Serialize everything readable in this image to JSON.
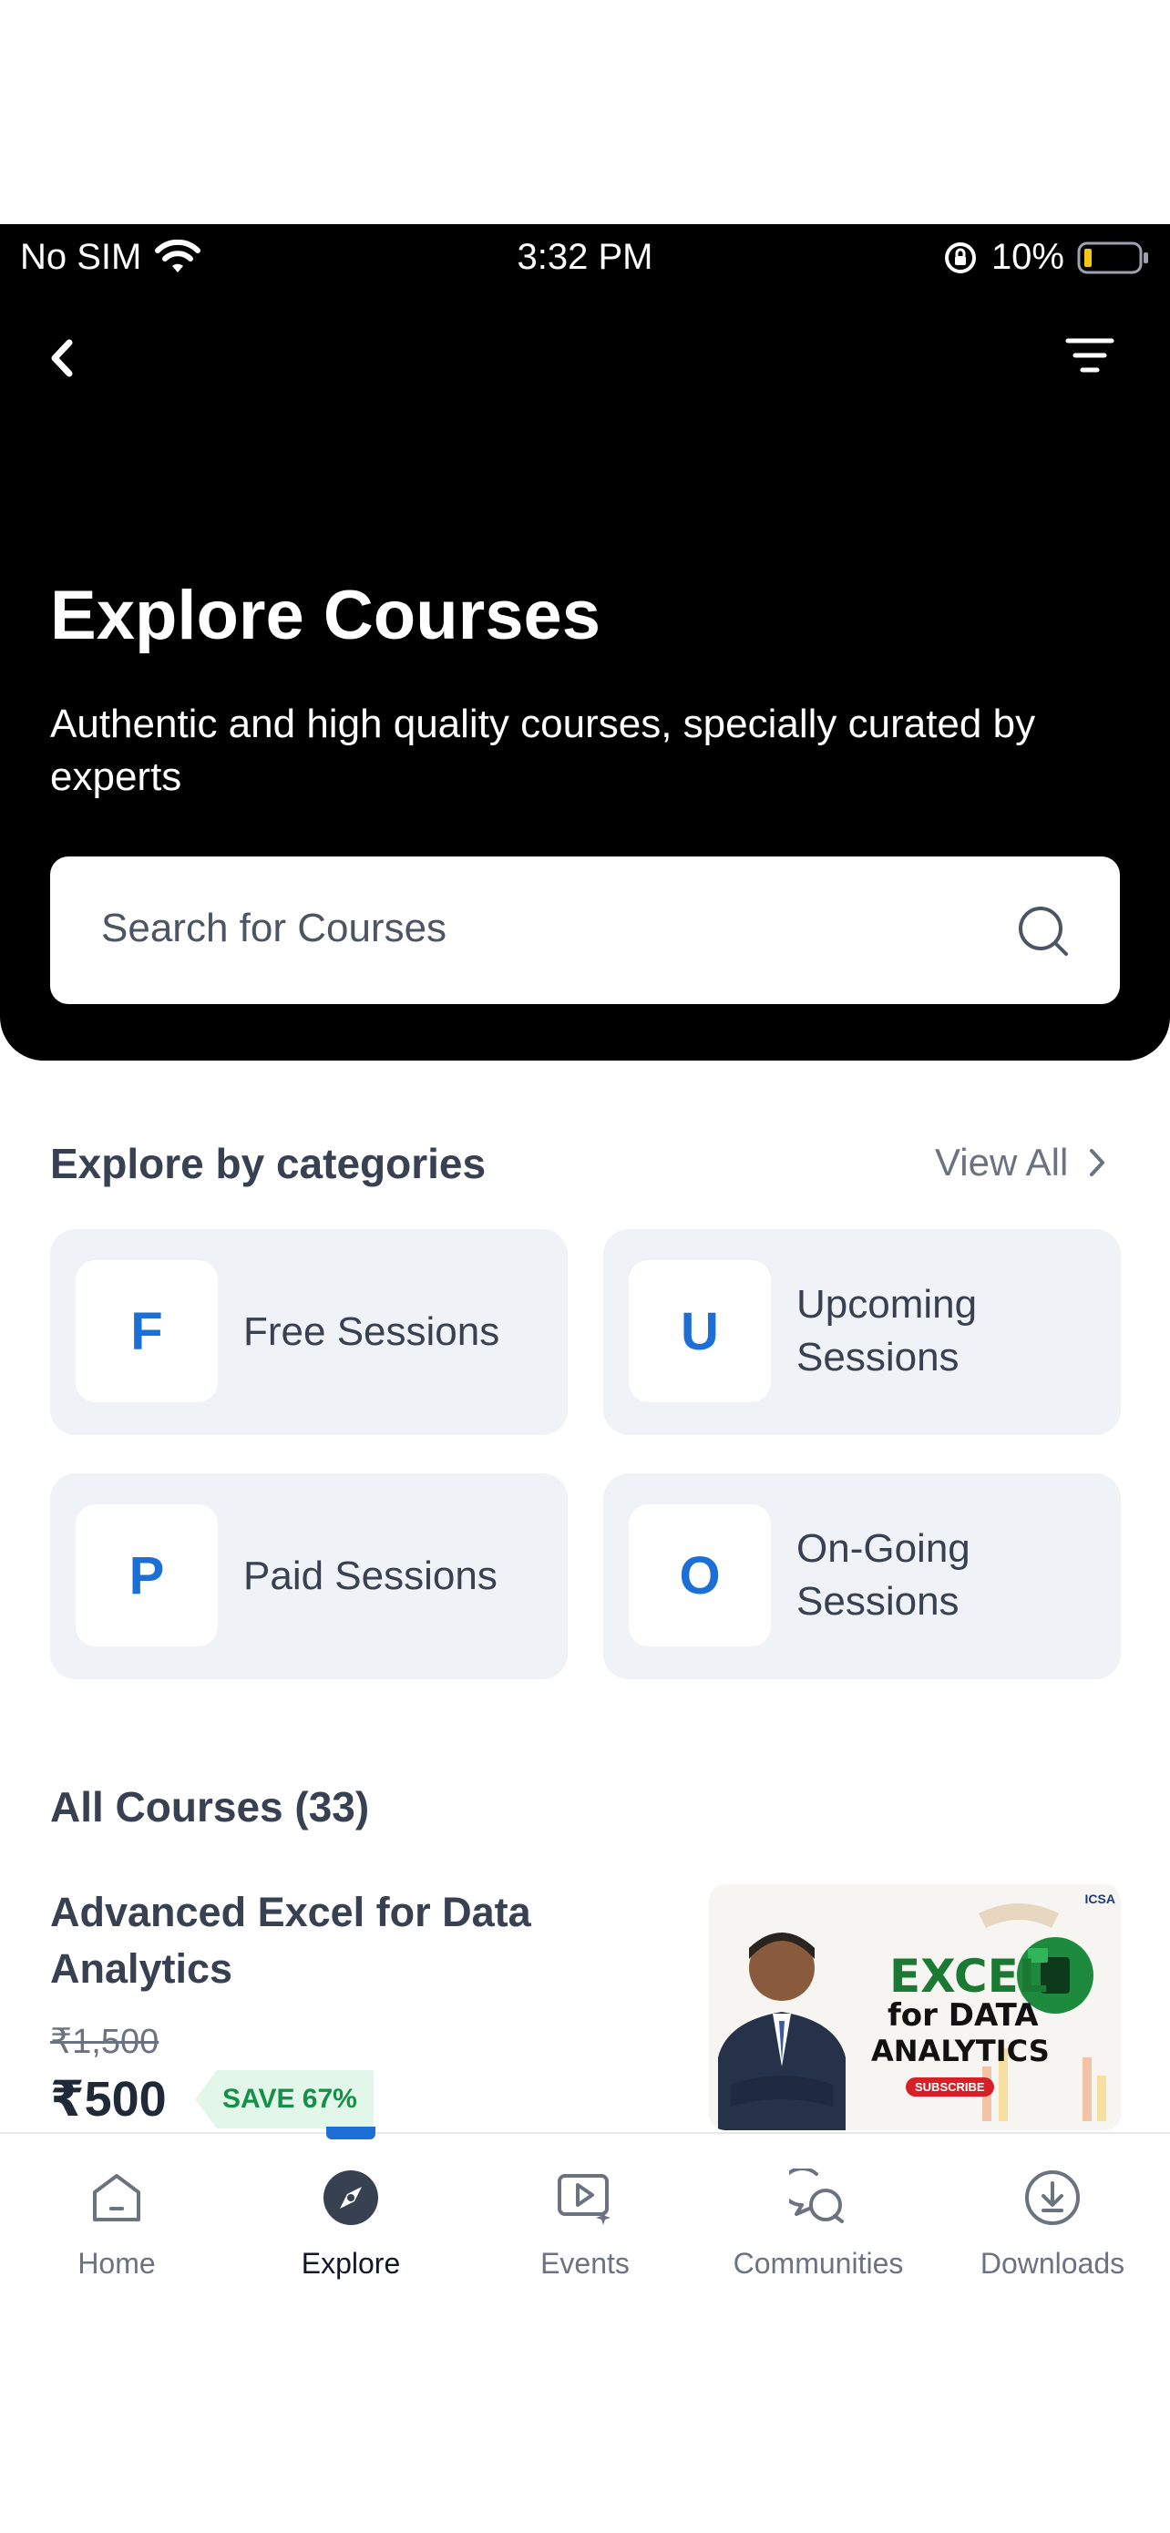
{
  "status_bar": {
    "carrier": "No SIM",
    "time": "3:32 PM",
    "battery": "10%"
  },
  "header": {
    "back_icon": "chevron-left-icon",
    "filter_icon": "filter-icon"
  },
  "page": {
    "title": "Explore Courses",
    "subtitle": "Authentic and high quality courses, specially curated by experts"
  },
  "search": {
    "placeholder": "Search for Courses"
  },
  "categories": {
    "title": "Explore by categories",
    "view_all": "View All",
    "items": [
      {
        "letter": "F",
        "label": "Free Sessions"
      },
      {
        "letter": "U",
        "label": "Upcoming Sessions"
      },
      {
        "letter": "P",
        "label": "Paid Sessions"
      },
      {
        "letter": "O",
        "label": "On-Going Sessions"
      }
    ]
  },
  "courses": {
    "title": "All Courses (33)",
    "items": [
      {
        "title": "Advanced Excel for Data Analytics",
        "old_price": "₹1,500",
        "price": "₹500",
        "badge": "SAVE 67%",
        "thumb": {
          "line1": "EXCEL",
          "line2": "for DATA",
          "line3": "ANALYTICS",
          "cta": "SUBSCRIBE",
          "logo": "ICSA"
        }
      }
    ]
  },
  "nav": {
    "active": "Explore",
    "accent": "#1d6fd8",
    "items": [
      {
        "label": "Home",
        "icon": "home-icon"
      },
      {
        "label": "Explore",
        "icon": "compass-icon"
      },
      {
        "label": "Events",
        "icon": "video-play-icon"
      },
      {
        "label": "Communities",
        "icon": "chat-bubbles-icon"
      },
      {
        "label": "Downloads",
        "icon": "download-icon"
      }
    ]
  }
}
